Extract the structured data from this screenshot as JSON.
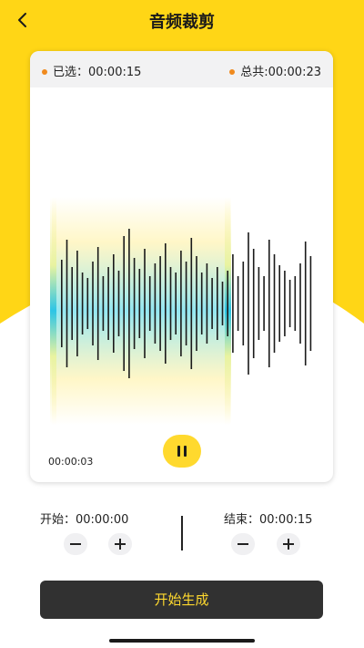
{
  "header": {
    "title": "音频裁剪",
    "back_icon": "chevron-left-icon"
  },
  "card": {
    "selected_text": "已选：00:00:15",
    "total_text": "总共:00:00:23",
    "current_time": "00:00:03",
    "play_state": "playing",
    "dot_color": "#f08a1e"
  },
  "controls": {
    "start_label": "开始：00:00:00",
    "end_label": "结束：00:00:15"
  },
  "generate_button": "开始生成",
  "colors": {
    "accent": "#ffd92e",
    "button_bg": "#313131",
    "selection": "#7fe0ef"
  }
}
